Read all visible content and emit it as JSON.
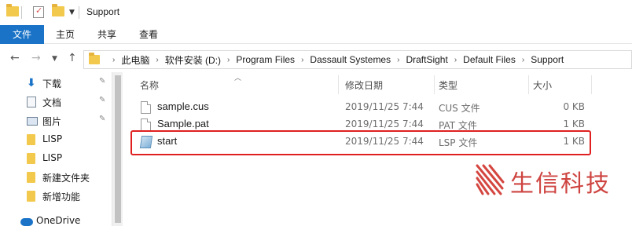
{
  "window": {
    "title": "Support"
  },
  "ribbon": {
    "tabs": [
      {
        "label": "文件",
        "active": true
      },
      {
        "label": "主页",
        "active": false
      },
      {
        "label": "共享",
        "active": false
      },
      {
        "label": "查看",
        "active": false
      }
    ]
  },
  "nav_buttons": {
    "back_icon": "arrow-left-icon",
    "forward_icon": "arrow-right-icon",
    "recent_icon": "chevron-down-icon",
    "up_icon": "arrow-up-icon"
  },
  "breadcrumb": [
    "此电脑",
    "软件安装 (D:)",
    "Program Files",
    "Dassault Systemes",
    "DraftSight",
    "Default Files",
    "Support"
  ],
  "sidebar": {
    "items": [
      {
        "label": "下载",
        "icon": "download-icon",
        "pinned": true
      },
      {
        "label": "文档",
        "icon": "document-icon",
        "pinned": true
      },
      {
        "label": "图片",
        "icon": "picture-icon",
        "pinned": true
      },
      {
        "label": "LISP",
        "icon": "folder-icon",
        "pinned": false
      },
      {
        "label": "LISP",
        "icon": "folder-icon",
        "pinned": false
      },
      {
        "label": "新建文件夹",
        "icon": "folder-icon",
        "pinned": false
      },
      {
        "label": "新增功能",
        "icon": "folder-icon",
        "pinned": false
      },
      {
        "label": "OneDrive",
        "icon": "cloud-icon",
        "pinned": false
      }
    ]
  },
  "columns": {
    "name": "名称",
    "date": "修改日期",
    "type": "类型",
    "size": "大小"
  },
  "files": [
    {
      "name": "sample.cus",
      "date": "2019/11/25 7:44",
      "type": "CUS 文件",
      "size": "0 KB",
      "icon": "file-icon"
    },
    {
      "name": "Sample.pat",
      "date": "2019/11/25 7:44",
      "type": "PAT 文件",
      "size": "1 KB",
      "icon": "file-icon"
    },
    {
      "name": "start",
      "date": "2019/11/25 7:44",
      "type": "LSP 文件",
      "size": "1 KB",
      "icon": "lsp-file-icon",
      "highlighted": true
    }
  ],
  "watermark": {
    "text": "生信科技"
  },
  "colors": {
    "accent": "#1a73c7",
    "highlight": "#e02020",
    "folder": "#f2c94c",
    "watermark": "#c9302c"
  }
}
